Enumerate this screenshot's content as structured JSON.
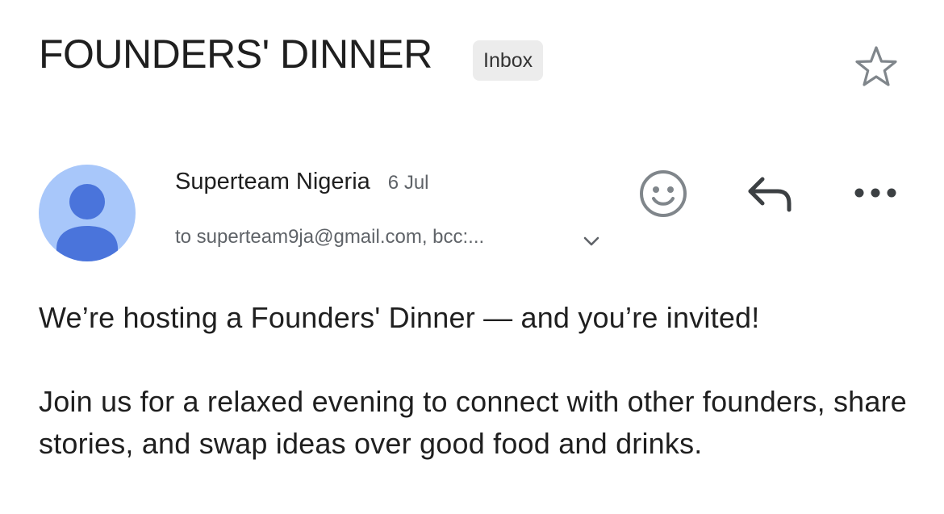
{
  "email": {
    "subject": "FOUNDERS' DINNER",
    "label": "Inbox",
    "starred": false
  },
  "sender": {
    "name": "Superteam Nigeria",
    "date": "6 Jul",
    "recipients": "to superteam9ja@gmail.com, bcc:..."
  },
  "actions": {
    "emoji_icon": "smiley-face-icon",
    "reply_icon": "reply-arrow-icon",
    "more_icon": "more-horizontal-icon"
  },
  "body": {
    "paragraphs": [
      "We’re hosting a Founders' Dinner — and you’re invited!",
      "Join us for a relaxed evening to connect with other founders, share stories, and swap ideas over good food and drinks."
    ]
  },
  "colors": {
    "avatar_bg": "#a8c7fa",
    "avatar_fg": "#4a74db",
    "chip_bg": "#ececec",
    "icon_gray": "#80868b",
    "secondary_text": "#5f6368"
  }
}
